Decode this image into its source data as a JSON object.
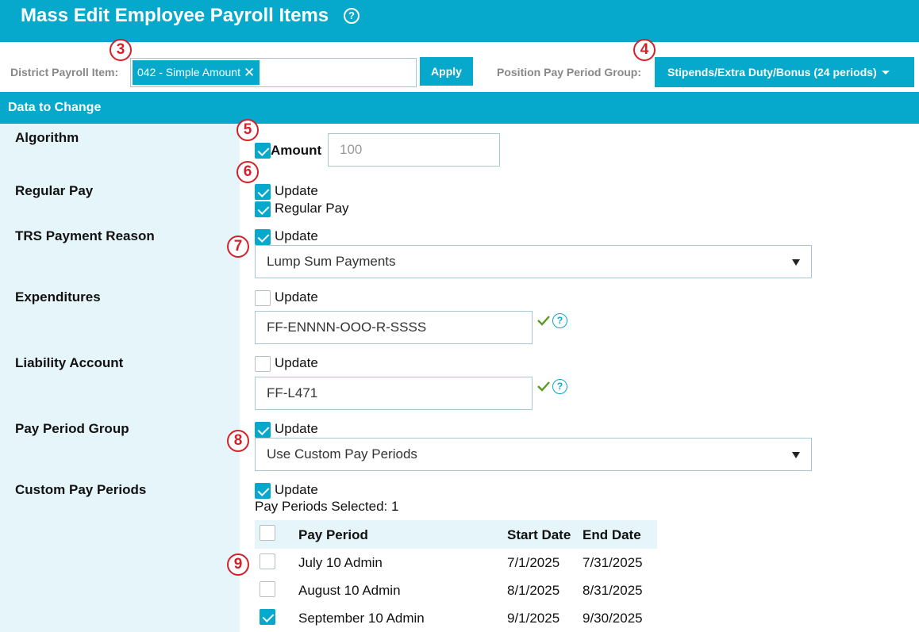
{
  "header": {
    "title": "Mass Edit Employee Payroll Items",
    "help_glyph": "?"
  },
  "filters": {
    "district_payroll_item_label": "District Payroll Item:",
    "district_payroll_item_value": "042 - Simple Amount",
    "apply_label": "Apply",
    "position_pay_period_group_label": "Position Pay Period Group:",
    "position_pay_period_group_value": "Stipends/Extra Duty/Bonus (24 periods)"
  },
  "section": {
    "title": "Data to Change"
  },
  "fields": {
    "algorithm": {
      "label": "Algorithm",
      "checkbox_label": "Amount",
      "checked": true,
      "input_placeholder": "100"
    },
    "regular_pay": {
      "label": "Regular Pay",
      "update_label": "Update",
      "update_checked": true,
      "regular_pay_label": "Regular Pay",
      "regular_pay_checked": true
    },
    "trs_payment_reason": {
      "label": "TRS Payment Reason",
      "update_label": "Update",
      "update_checked": true,
      "selected": "Lump Sum Payments"
    },
    "expenditures": {
      "label": "Expenditures",
      "update_label": "Update",
      "update_checked": false,
      "value": "FF-ENNNN-OOO-R-SSSS"
    },
    "liability_account": {
      "label": "Liability Account",
      "update_label": "Update",
      "update_checked": false,
      "value": "FF-L471"
    },
    "pay_period_group": {
      "label": "Pay Period Group",
      "update_label": "Update",
      "update_checked": true,
      "selected": "Use Custom Pay Periods"
    },
    "custom_pay_periods": {
      "label": "Custom Pay Periods",
      "update_label": "Update",
      "update_checked": true,
      "selected_count_text": "Pay Periods Selected: 1",
      "columns": [
        "Pay Period",
        "Start Date",
        "End Date"
      ],
      "rows": [
        {
          "name": "July 10 Admin",
          "start": "7/1/2025",
          "end": "7/31/2025",
          "checked": false
        },
        {
          "name": "August 10 Admin",
          "start": "8/1/2025",
          "end": "8/31/2025",
          "checked": false
        },
        {
          "name": "September 10 Admin",
          "start": "9/1/2025",
          "end": "9/30/2025",
          "checked": true
        }
      ]
    }
  },
  "steps": [
    "3",
    "4",
    "5",
    "6",
    "7",
    "8",
    "9"
  ],
  "colors": {
    "accent": "#06a9cb",
    "panel": "#e6f5fa",
    "step_red": "#d4202a",
    "valid_green": "#5a9a1e"
  }
}
